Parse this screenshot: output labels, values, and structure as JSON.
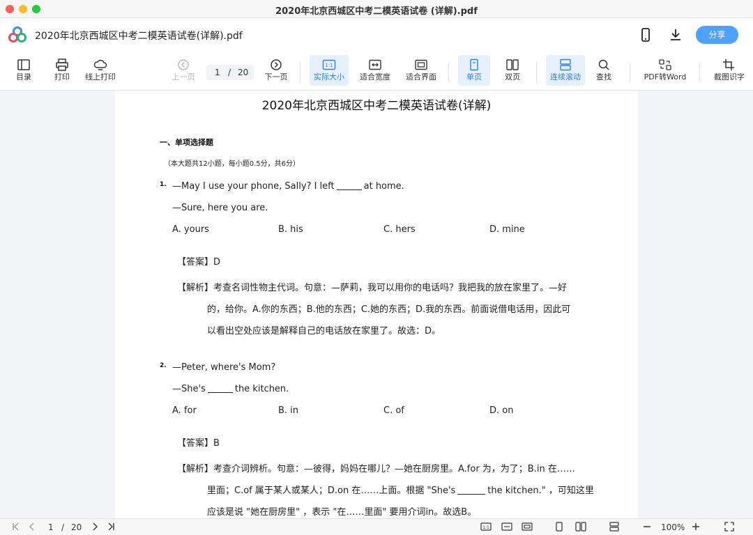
{
  "window": {
    "title": "2020年北京西城区中考二模英语试卷 (详解).pdf"
  },
  "header": {
    "file_title": "2020年北京西城区中考二模英语试卷(详解).pdf",
    "share_label": "分享"
  },
  "toolbar": {
    "toc": "目录",
    "print": "打印",
    "online_print": "线上打印",
    "prev": "上一页",
    "next": "下一页",
    "current_page": "1",
    "separator": "/",
    "total_pages": "20",
    "actual_size": "实际大小",
    "fit_width": "适合宽度",
    "fit_screen": "适合界面",
    "single": "单页",
    "double": "双页",
    "continuous": "连续滚动",
    "find": "查找",
    "pdf_to_word": "PDF转Word",
    "ocr": "截图识字",
    "ratio_icon_text": "1:1"
  },
  "doc": {
    "title": "2020年北京西城区中考二模英语试卷(详解)",
    "section_heading": "一、单项选择题",
    "section_note": "（本大题共12小题，每小题0.5分，共6分）",
    "q1": {
      "num": "1.",
      "line1_a": "—May I use your phone, Sally? I left",
      "line1_b": "at home.",
      "line2": "—Sure, here you are.",
      "options": [
        "A. yours",
        "B. his",
        "C. hers",
        "D. mine"
      ],
      "answer": "【答案】D",
      "expl": [
        "【解析】考查名词性物主代词。句意：—萨莉，我可以用你的电话吗？我把我的放在家里了。—好",
        "的，给你。A.你的东西；B.他的东西；C.她的东西；D.我的东西。前面说借电话用，因此可",
        "以看出空处应该是解释自己的电话放在家里了。故选：D。"
      ]
    },
    "q2": {
      "num": "2.",
      "line1": "—Peter, where's Mom?",
      "line2_a": "—She's",
      "line2_b": "the kitchen.",
      "options": [
        "A. for",
        "B. in",
        "C. of",
        "D. on"
      ],
      "answer": "【答案】B",
      "expl1": "【解析】考查介词辨析。句意：—彼得，妈妈在哪儿？—她在厨房里。A.for 为，为了；B.in 在……",
      "expl2_a": "里面；C.of 属于某人或某人；D.on 在……上面。根据 \"She's",
      "expl2_b": "the kitchen.\" ，可知这里",
      "expl3": "应该是说 \"她在厨房里\" ，表示 \"在……里面\" 要用介词in。故选B。"
    }
  },
  "bottom": {
    "current_page": "1",
    "separator": "/",
    "total_pages": "20",
    "ratio_icon_text": "1:1",
    "zoom": "100%"
  }
}
